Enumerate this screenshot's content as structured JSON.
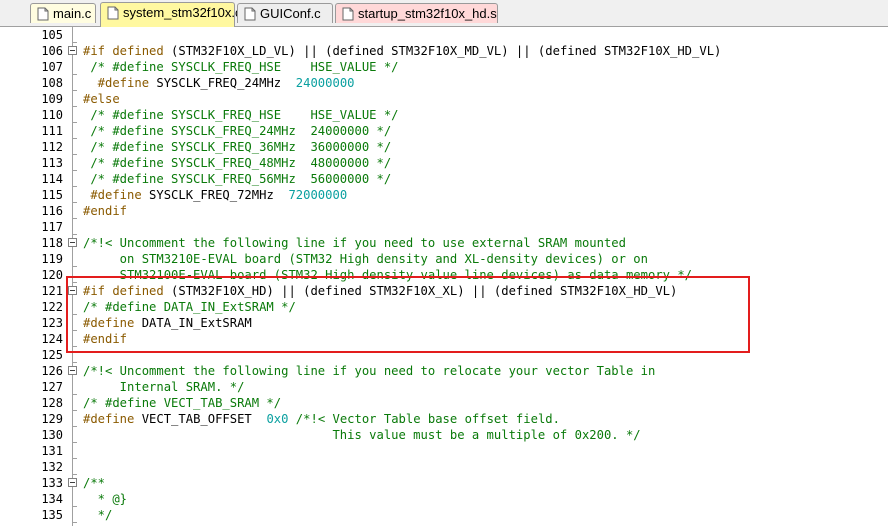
{
  "tabs": [
    {
      "label": "main.c",
      "color": "#fffde0",
      "active": false
    },
    {
      "label": "system_stm32f10x.c",
      "color": "#fff8a0",
      "active": true
    },
    {
      "label": "GUIConf.c",
      "color": "#eeeeee",
      "active": false
    },
    {
      "label": "startup_stm32f10x_hd.s",
      "color": "#ffd8d8",
      "active": false
    }
  ],
  "colors": {
    "comment": "#0a7a0a",
    "preprocessor": "#8a5a00",
    "number": "#0aa0a0",
    "highlight": "#e31d1d"
  },
  "lines": [
    {
      "n": "105",
      "fold": false,
      "segs": []
    },
    {
      "n": "106",
      "fold": true,
      "segs": [
        [
          "pre",
          "#if defined"
        ],
        [
          "text",
          " (STM32F10X_LD_VL) || (defined STM32F10X_MD_VL) || (defined STM32F10X_HD_VL)"
        ]
      ]
    },
    {
      "n": "107",
      "fold": false,
      "segs": [
        [
          "comment",
          " /* #define SYSCLK_FREQ_HSE    HSE_VALUE */"
        ]
      ]
    },
    {
      "n": "108",
      "fold": false,
      "segs": [
        [
          "pre",
          "  #define"
        ],
        [
          "text",
          " SYSCLK_FREQ_24MHz  "
        ],
        [
          "num",
          "24000000"
        ]
      ]
    },
    {
      "n": "109",
      "fold": false,
      "segs": [
        [
          "pre",
          "#else"
        ]
      ]
    },
    {
      "n": "110",
      "fold": false,
      "segs": [
        [
          "comment",
          " /* #define SYSCLK_FREQ_HSE    HSE_VALUE */"
        ]
      ]
    },
    {
      "n": "111",
      "fold": false,
      "segs": [
        [
          "comment",
          " /* #define SYSCLK_FREQ_24MHz  24000000 */"
        ]
      ]
    },
    {
      "n": "112",
      "fold": false,
      "segs": [
        [
          "comment",
          " /* #define SYSCLK_FREQ_36MHz  36000000 */"
        ]
      ]
    },
    {
      "n": "113",
      "fold": false,
      "segs": [
        [
          "comment",
          " /* #define SYSCLK_FREQ_48MHz  48000000 */"
        ]
      ]
    },
    {
      "n": "114",
      "fold": false,
      "segs": [
        [
          "comment",
          " /* #define SYSCLK_FREQ_56MHz  56000000 */"
        ]
      ]
    },
    {
      "n": "115",
      "fold": false,
      "segs": [
        [
          "pre",
          " #define"
        ],
        [
          "text",
          " SYSCLK_FREQ_72MHz  "
        ],
        [
          "num",
          "72000000"
        ]
      ]
    },
    {
      "n": "116",
      "fold": false,
      "segs": [
        [
          "pre",
          "#endif"
        ]
      ]
    },
    {
      "n": "117",
      "fold": false,
      "segs": []
    },
    {
      "n": "118",
      "fold": true,
      "segs": [
        [
          "comment",
          "/*!< Uncomment the following line if you need to use external SRAM mounted"
        ]
      ]
    },
    {
      "n": "119",
      "fold": false,
      "segs": [
        [
          "comment",
          "     on STM3210E-EVAL board (STM32 High density and XL-density devices) or on"
        ]
      ]
    },
    {
      "n": "120",
      "fold": false,
      "segs": [
        [
          "comment",
          "     STM32100E-EVAL board (STM32 High density value line devices) as data memory */"
        ]
      ]
    },
    {
      "n": "121",
      "fold": true,
      "segs": [
        [
          "pre",
          "#if defined"
        ],
        [
          "text",
          " (STM32F10X_HD) || (defined STM32F10X_XL) || (defined STM32F10X_HD_VL)"
        ]
      ]
    },
    {
      "n": "122",
      "fold": false,
      "segs": [
        [
          "comment",
          "/* #define DATA_IN_ExtSRAM */"
        ]
      ]
    },
    {
      "n": "123",
      "fold": false,
      "segs": [
        [
          "pre",
          "#define"
        ],
        [
          "text",
          " DATA_IN_ExtSRAM"
        ]
      ]
    },
    {
      "n": "124",
      "fold": false,
      "segs": [
        [
          "pre",
          "#endif"
        ]
      ]
    },
    {
      "n": "125",
      "fold": false,
      "segs": []
    },
    {
      "n": "126",
      "fold": true,
      "segs": [
        [
          "comment",
          "/*!< Uncomment the following line if you need to relocate your vector Table in"
        ]
      ]
    },
    {
      "n": "127",
      "fold": false,
      "segs": [
        [
          "comment",
          "     Internal SRAM. */"
        ]
      ]
    },
    {
      "n": "128",
      "fold": false,
      "segs": [
        [
          "comment",
          "/* #define VECT_TAB_SRAM */"
        ]
      ]
    },
    {
      "n": "129",
      "fold": false,
      "segs": [
        [
          "pre",
          "#define"
        ],
        [
          "text",
          " VECT_TAB_OFFSET  "
        ],
        [
          "num",
          "0x0"
        ],
        [
          "comment",
          " /*!< Vector Table base offset field."
        ]
      ]
    },
    {
      "n": "130",
      "fold": false,
      "segs": [
        [
          "comment",
          "                                  This value must be a multiple of 0x200. */"
        ]
      ]
    },
    {
      "n": "131",
      "fold": false,
      "segs": []
    },
    {
      "n": "132",
      "fold": false,
      "segs": []
    },
    {
      "n": "133",
      "fold": true,
      "segs": [
        [
          "comment",
          "/**"
        ]
      ]
    },
    {
      "n": "134",
      "fold": false,
      "segs": [
        [
          "comment",
          "  * @}"
        ]
      ]
    },
    {
      "n": "135",
      "fold": false,
      "segs": [
        [
          "comment",
          "  */"
        ]
      ]
    }
  ]
}
